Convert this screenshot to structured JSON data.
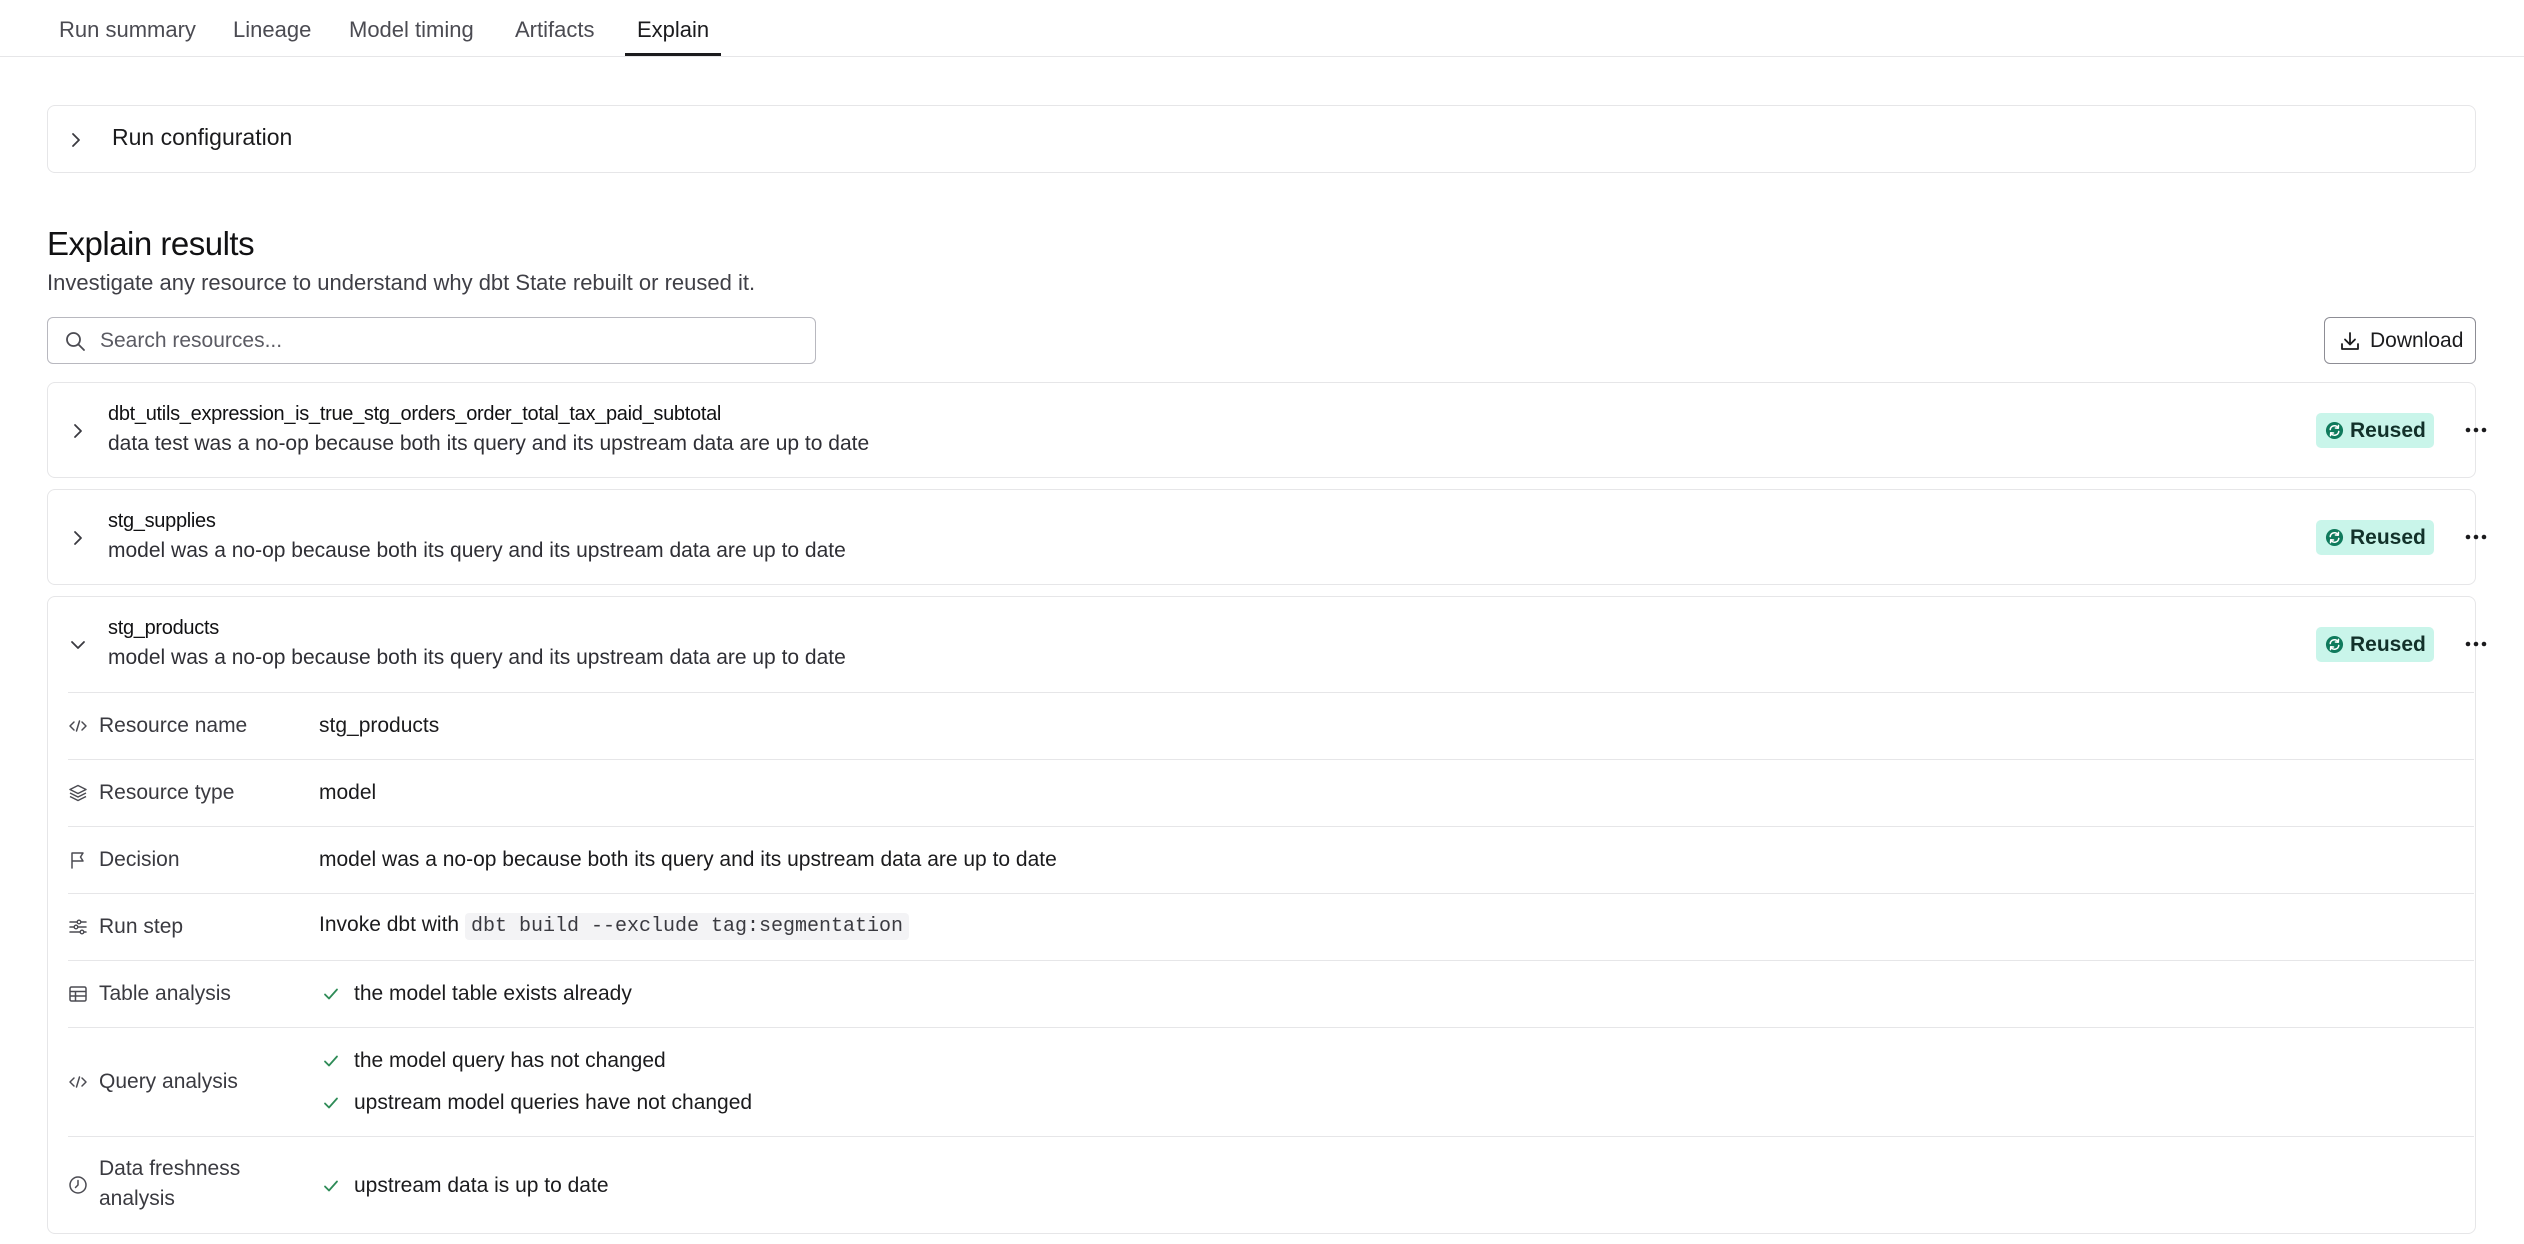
{
  "tabs": [
    "Run summary",
    "Lineage",
    "Model timing",
    "Artifacts",
    "Explain"
  ],
  "active_tab": "Explain",
  "run_config": {
    "title": "Run configuration"
  },
  "explain": {
    "title": "Explain results",
    "subtitle": "Investigate any resource to understand why dbt State rebuilt or reused it.",
    "search_placeholder": "Search resources...",
    "search_value": "",
    "download_label": "Download"
  },
  "resources": [
    {
      "name": "dbt_utils_expression_is_true_stg_orders_order_total_tax_paid_subtotal",
      "description": "data test was a no-op because both its query and its upstream data are up to date",
      "status": "Reused",
      "expanded": false
    },
    {
      "name": "stg_supplies",
      "description": "model was a no-op because both its query and its upstream data are up to date",
      "status": "Reused",
      "expanded": false
    },
    {
      "name": "stg_products",
      "description": "model was a no-op because both its query and its upstream data are up to date",
      "status": "Reused",
      "expanded": true
    }
  ],
  "details": {
    "resource_name": {
      "label": "Resource name",
      "value": "stg_products"
    },
    "resource_type": {
      "label": "Resource type",
      "value": "model"
    },
    "decision": {
      "label": "Decision",
      "value": "model was a no-op because both its query and its upstream data are up to date"
    },
    "run_step": {
      "label": "Run step",
      "prefix": "Invoke dbt with",
      "command": "dbt build --exclude tag:segmentation"
    },
    "table_analysis": {
      "label": "Table analysis",
      "checks": [
        "the model table exists already"
      ]
    },
    "query_analysis": {
      "label": "Query analysis",
      "checks": [
        "the model query has not changed",
        "upstream model queries have not changed"
      ]
    },
    "data_freshness": {
      "label_line1": "Data freshness",
      "label_line2": "analysis",
      "checks": [
        "upstream data is up to date"
      ]
    }
  },
  "colors": {
    "badge_bg": "#c9f5ea",
    "badge_icon": "#0f7a5c",
    "check": "#2e8b57",
    "border": "#e6e6e8"
  }
}
